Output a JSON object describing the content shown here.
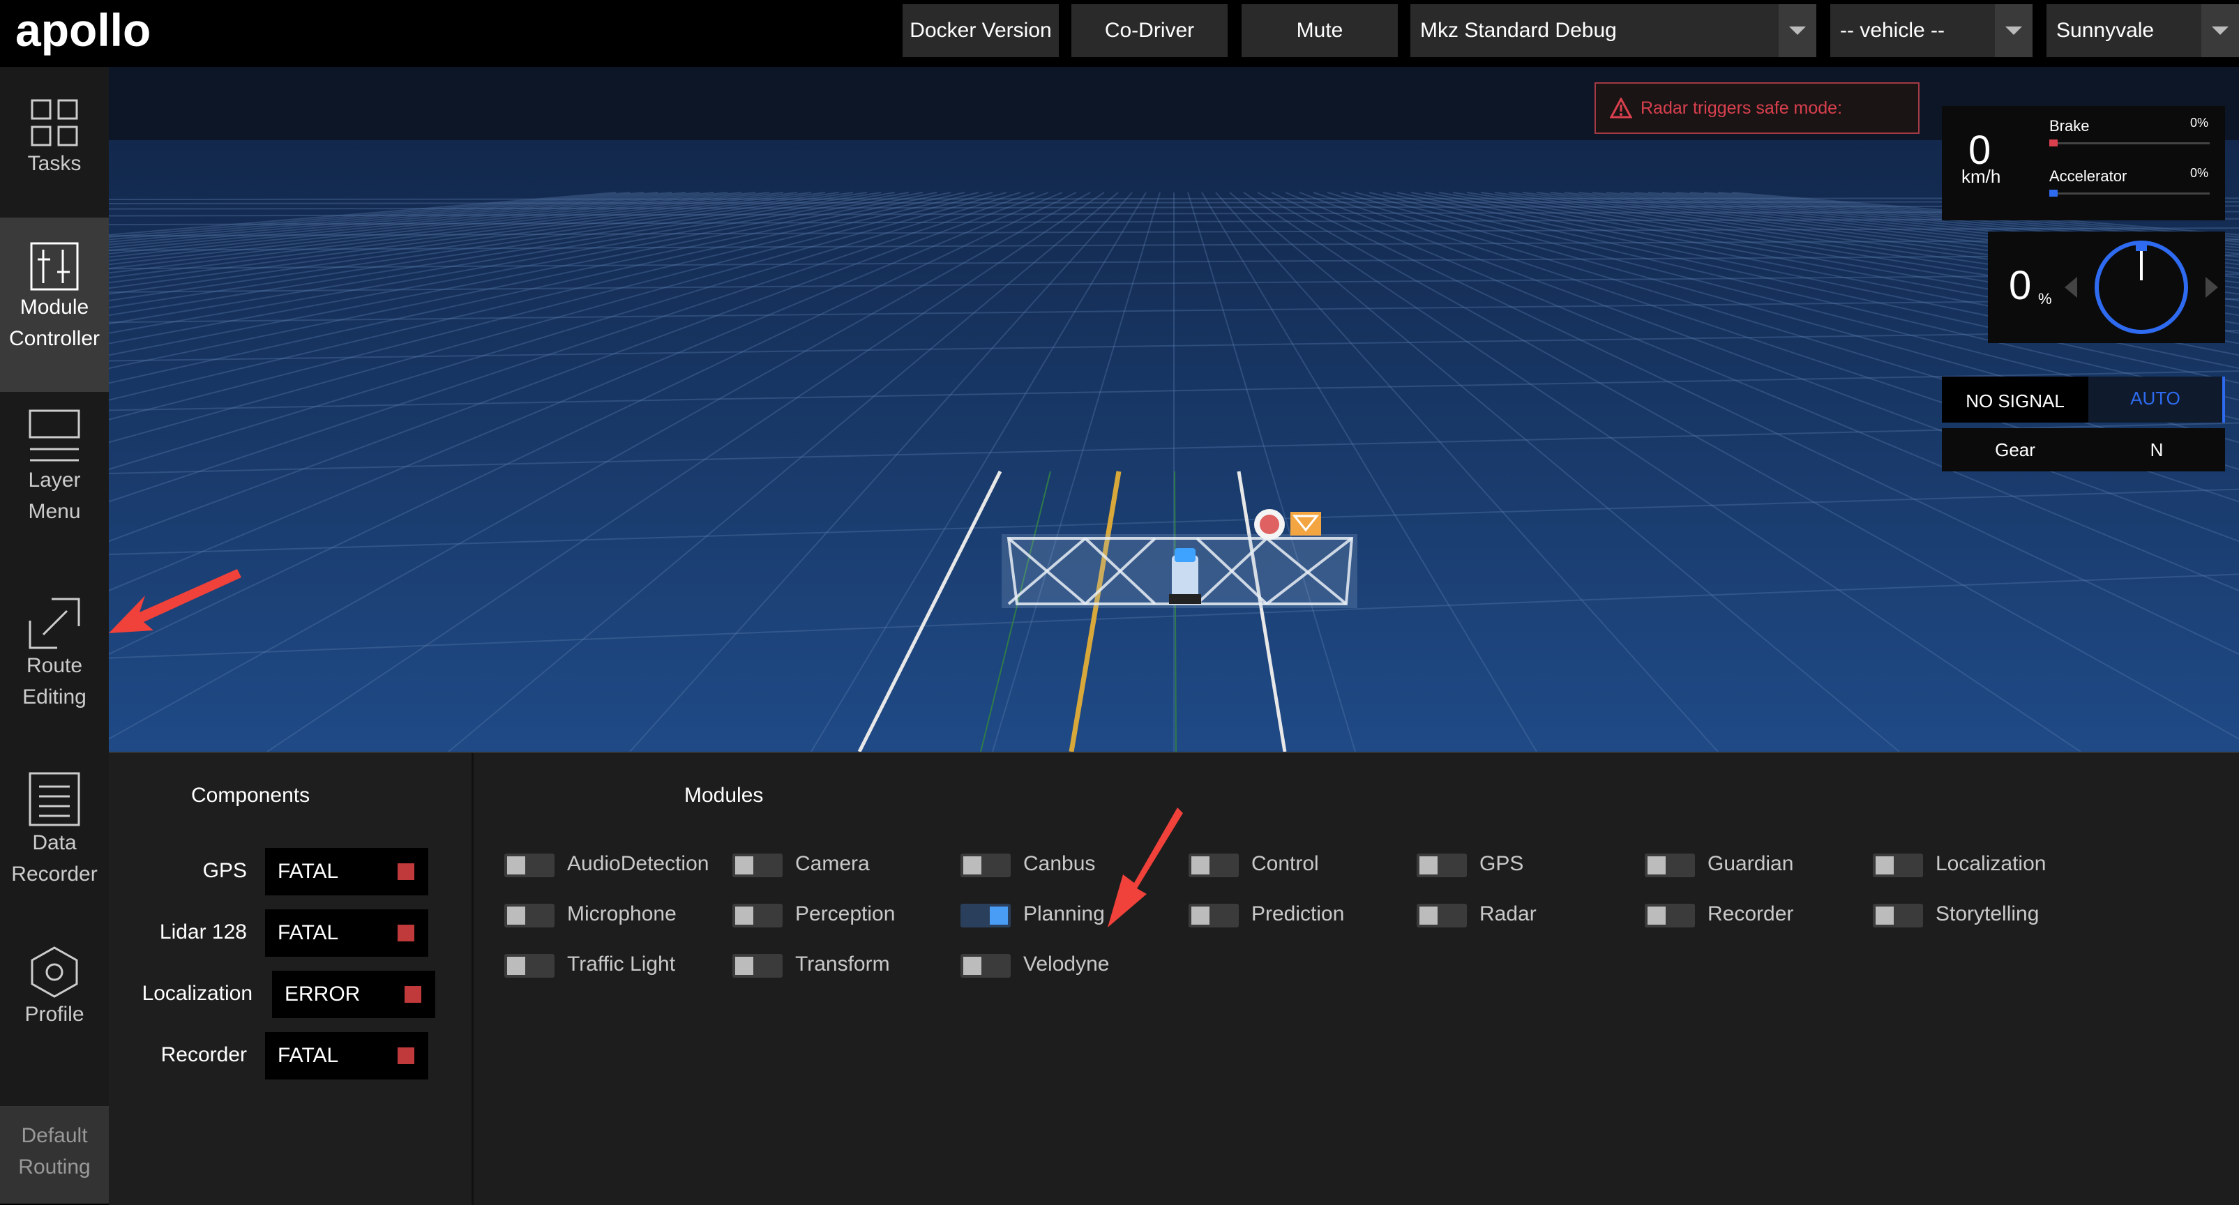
{
  "header": {
    "logo_text": "apollo",
    "docker_label": "Docker Version",
    "codriver_label": "Co-Driver",
    "mute_label": "Mute",
    "mode_select": "Mkz Standard Debug",
    "vehicle_select": "-- vehicle --",
    "map_select": "Sunnyvale"
  },
  "sidebar": {
    "tasks": [
      "Tasks"
    ],
    "module_controller": [
      "Module",
      "Controller"
    ],
    "layer_menu": [
      "Layer",
      "Menu"
    ],
    "route_editing": [
      "Route",
      "Editing"
    ],
    "data_recorder": [
      "Data",
      "Recorder"
    ],
    "profile": [
      "Profile"
    ],
    "default_routing": [
      "Default",
      "Routing"
    ]
  },
  "scene": {
    "warning_text": "Radar triggers safe mode:"
  },
  "dashboard": {
    "speed": "0",
    "speed_unit": "km/h",
    "brake_label": "Brake",
    "brake_value": "0%",
    "accel_label": "Accelerator",
    "accel_value": "0%",
    "steering_value": "0",
    "steering_unit": "%",
    "signal_label": "NO SIGNAL",
    "drive_mode": "AUTO",
    "gear_label": "Gear",
    "gear_value": "N",
    "colors": {
      "brake": "#d9404e",
      "accel": "#2e6bf0",
      "auto": "#2e6bf0"
    }
  },
  "components": {
    "title": "Components",
    "items": [
      {
        "name": "GPS",
        "status": "FATAL"
      },
      {
        "name": "Lidar 128",
        "status": "FATAL"
      },
      {
        "name": "Localization",
        "status": "ERROR"
      },
      {
        "name": "Recorder",
        "status": "FATAL"
      }
    ],
    "status_color": "#c0393b"
  },
  "modules": {
    "title": "Modules",
    "items": [
      {
        "name": "AudioDetection",
        "on": false
      },
      {
        "name": "Camera",
        "on": false
      },
      {
        "name": "Canbus",
        "on": false
      },
      {
        "name": "Control",
        "on": false
      },
      {
        "name": "GPS",
        "on": false
      },
      {
        "name": "Guardian",
        "on": false
      },
      {
        "name": "Localization",
        "on": false
      },
      {
        "name": "Microphone",
        "on": false
      },
      {
        "name": "Perception",
        "on": false
      },
      {
        "name": "Planning",
        "on": true
      },
      {
        "name": "Prediction",
        "on": false
      },
      {
        "name": "Radar",
        "on": false
      },
      {
        "name": "Recorder",
        "on": false
      },
      {
        "name": "Storytelling",
        "on": false
      },
      {
        "name": "Traffic Light",
        "on": false
      },
      {
        "name": "Transform",
        "on": false
      },
      {
        "name": "Velodyne",
        "on": false
      }
    ]
  },
  "annotations": {
    "arrow_color": "#f0413a"
  }
}
